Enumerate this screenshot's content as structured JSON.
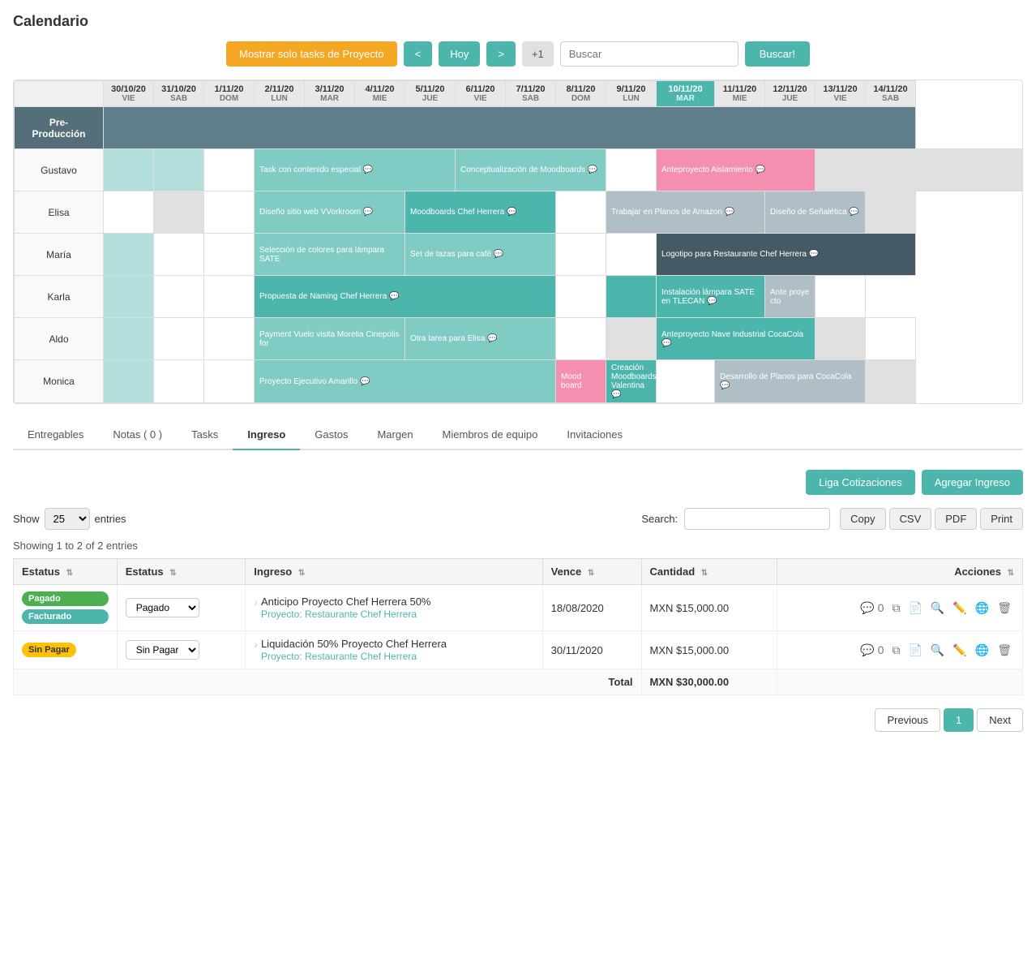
{
  "page": {
    "title": "Calendario"
  },
  "toolbar": {
    "filter_btn": "Mostrar solo tasks de Proyecto",
    "prev_btn": "<",
    "today_btn": "Hoy",
    "next_btn": ">",
    "plus_btn": "+1",
    "search_placeholder": "Buscar",
    "search_btn": "Buscar!"
  },
  "calendar": {
    "columns": [
      {
        "date": "30/10/20",
        "day": "VIE",
        "today": false
      },
      {
        "date": "31/10/20",
        "day": "SAB",
        "today": false
      },
      {
        "date": "1/11/20",
        "day": "DOM",
        "today": false
      },
      {
        "date": "2/11/20",
        "day": "LUN",
        "today": false
      },
      {
        "date": "3/11/20",
        "day": "MAR",
        "today": false
      },
      {
        "date": "4/11/20",
        "day": "MIE",
        "today": false
      },
      {
        "date": "5/11/20",
        "day": "JUE",
        "today": false
      },
      {
        "date": "6/11/20",
        "day": "VIE",
        "today": false
      },
      {
        "date": "7/11/20",
        "day": "SAB",
        "today": false
      },
      {
        "date": "8/11/20",
        "day": "DOM",
        "today": false
      },
      {
        "date": "9/11/20",
        "day": "LUN",
        "today": false
      },
      {
        "date": "10/11/20",
        "day": "MAR",
        "today": true
      },
      {
        "date": "11/11/20",
        "day": "MIE",
        "today": false
      },
      {
        "date": "12/11/20",
        "day": "JUE",
        "today": false
      },
      {
        "date": "13/11/20",
        "day": "VIE",
        "today": false
      },
      {
        "date": "14/11/20",
        "day": "SAB",
        "today": false
      }
    ],
    "rows": [
      {
        "label": "Pre-Producción",
        "dark": true
      },
      {
        "label": "Gustavo",
        "dark": false
      },
      {
        "label": "Elisa",
        "dark": false
      },
      {
        "label": "María",
        "dark": false
      },
      {
        "label": "Karla",
        "dark": false
      },
      {
        "label": "Aldo",
        "dark": false
      },
      {
        "label": "Monica",
        "dark": false
      }
    ]
  },
  "tabs": {
    "items": [
      "Entregables",
      "Notas ( 0 )",
      "Tasks",
      "Ingreso",
      "Gastos",
      "Margen",
      "Miembros de equipo",
      "Invitaciones"
    ],
    "active": "Ingreso"
  },
  "ingreso": {
    "liga_btn": "Liga Cotizaciones",
    "agregar_btn": "Agregar Ingreso",
    "show_label": "Show",
    "entries_label": "entries",
    "show_value": "25",
    "search_label": "Search:",
    "showing_text": "Showing 1 to 2 of 2 entries",
    "export_btns": [
      "Copy",
      "CSV",
      "PDF",
      "Print"
    ],
    "columns": [
      "Estatus",
      "Estatus",
      "Ingreso",
      "Vence",
      "Cantidad",
      "Acciones"
    ],
    "rows": [
      {
        "badge1": "Pagado",
        "badge1_color": "green",
        "badge2": "Facturado",
        "badge2_color": "teal",
        "status_dropdown": "Pagado",
        "ingreso_title": "Anticipo Proyecto Chef Herrera 50%",
        "project": "Proyecto: Restaurante Chef Herrera",
        "vence": "18/08/2020",
        "cantidad": "MXN $15,000.00",
        "comments": "0"
      },
      {
        "badge1": "Sin Pagar",
        "badge1_color": "yellow",
        "badge2": "",
        "badge2_color": "",
        "status_dropdown": "Sin Pagar",
        "ingreso_title": "Liquidación 50% Proyecto Chef Herrera",
        "project": "Proyecto: Restaurante Chef Herrera",
        "vence": "30/11/2020",
        "cantidad": "MXN $15,000.00",
        "comments": "0"
      }
    ],
    "total_label": "Total",
    "total_amount": "MXN $30,000.00"
  },
  "pagination": {
    "prev": "Previous",
    "page": "1",
    "next": "Next"
  }
}
